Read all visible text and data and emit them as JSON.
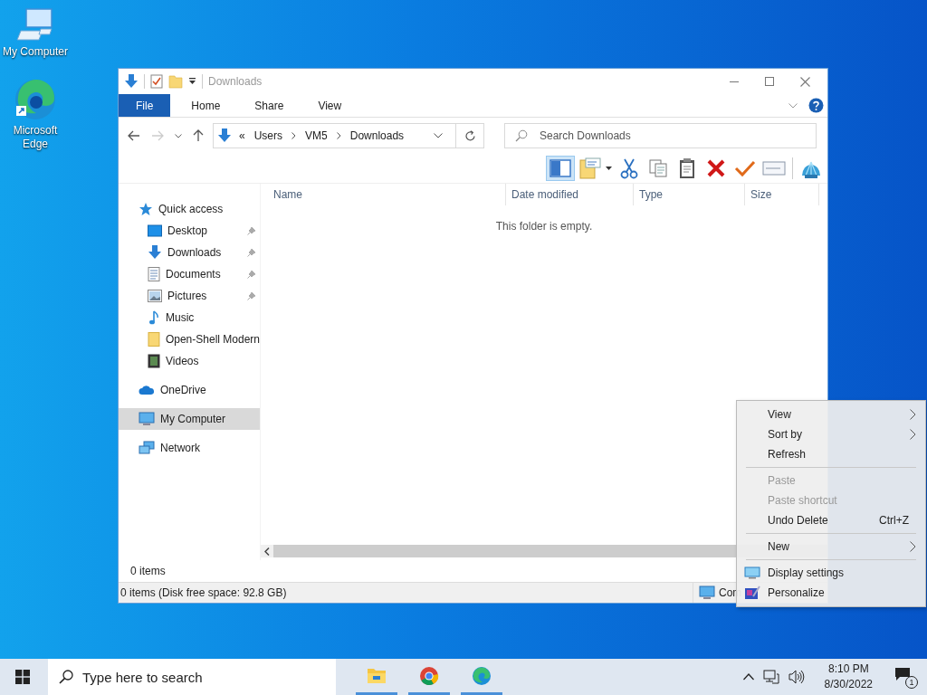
{
  "desktop_icons": [
    {
      "label": "My Computer",
      "kind": "computer"
    },
    {
      "label": "Microsoft Edge",
      "kind": "edge"
    }
  ],
  "explorer": {
    "title": "Downloads",
    "ribbon_tabs": [
      {
        "label": "File",
        "selected": true
      },
      {
        "label": "Home",
        "selected": false
      },
      {
        "label": "Share",
        "selected": false
      },
      {
        "label": "View",
        "selected": false
      }
    ],
    "breadcrumb_overflow": "«",
    "breadcrumb": [
      "Users",
      "VM5",
      "Downloads"
    ],
    "search": {
      "placeholder": "Search Downloads"
    },
    "toolbar": [
      {
        "kind": "pane",
        "selected": true
      },
      {
        "kind": "properties",
        "selected": false
      },
      {
        "kind": "cut",
        "selected": false
      },
      {
        "kind": "copy",
        "selected": false
      },
      {
        "kind": "paste",
        "selected": false
      },
      {
        "kind": "delete",
        "selected": false
      },
      {
        "kind": "check",
        "selected": false
      },
      {
        "kind": "rename",
        "selected": false
      },
      {
        "kind": "shell",
        "selected": false
      }
    ],
    "nav": [
      {
        "label": "Quick access",
        "kind": "star",
        "selected": false,
        "children": [
          {
            "label": "Desktop",
            "kind": "desktop",
            "pinned": true,
            "selected": false
          },
          {
            "label": "Downloads",
            "kind": "download",
            "pinned": true,
            "selected": false
          },
          {
            "label": "Documents",
            "kind": "document",
            "pinned": true,
            "selected": false
          },
          {
            "label": "Pictures",
            "kind": "pictures",
            "pinned": true,
            "selected": false
          },
          {
            "label": "Music",
            "kind": "music",
            "pinned": false,
            "selected": false
          },
          {
            "label": "Open-Shell Modern",
            "kind": "folder",
            "pinned": false,
            "selected": false
          },
          {
            "label": "Videos",
            "kind": "videos",
            "pinned": false,
            "selected": false
          }
        ]
      },
      {
        "label": "OneDrive",
        "kind": "cloud",
        "selected": false
      },
      {
        "label": "My Computer",
        "kind": "computer",
        "selected": true
      },
      {
        "label": "Network",
        "kind": "network",
        "selected": false
      }
    ],
    "columns": [
      "Name",
      "Date modified",
      "Type",
      "Size"
    ],
    "empty_message": "This folder is empty.",
    "item_count": "0 items",
    "status_bar": {
      "text": "0 items (Disk free space: 92.8 GB)",
      "location": "Com"
    }
  },
  "context_menu": [
    {
      "kind": "submenu",
      "label": "View",
      "disabled": false
    },
    {
      "kind": "submenu",
      "label": "Sort by",
      "disabled": false
    },
    {
      "kind": "item",
      "label": "Refresh",
      "disabled": false
    },
    {
      "kind": "separator"
    },
    {
      "kind": "item",
      "label": "Paste",
      "disabled": true
    },
    {
      "kind": "item",
      "label": "Paste shortcut",
      "disabled": true
    },
    {
      "kind": "item",
      "label": "Undo Delete",
      "shortcut": "Ctrl+Z",
      "disabled": false
    },
    {
      "kind": "separator"
    },
    {
      "kind": "submenu",
      "label": "New",
      "disabled": false
    },
    {
      "kind": "separator"
    },
    {
      "kind": "display",
      "label": "Display settings",
      "disabled": false
    },
    {
      "kind": "personalize",
      "label": "Personalize",
      "disabled": false
    }
  ],
  "taskbar": {
    "search": {
      "placeholder": "Type here to search"
    },
    "apps": [
      {
        "kind": "folder",
        "running": true
      },
      {
        "kind": "chrome",
        "running": true
      },
      {
        "kind": "edge",
        "running": true
      }
    ],
    "time": "8:10 PM",
    "date": "8/30/2022",
    "notification_count": "1"
  }
}
